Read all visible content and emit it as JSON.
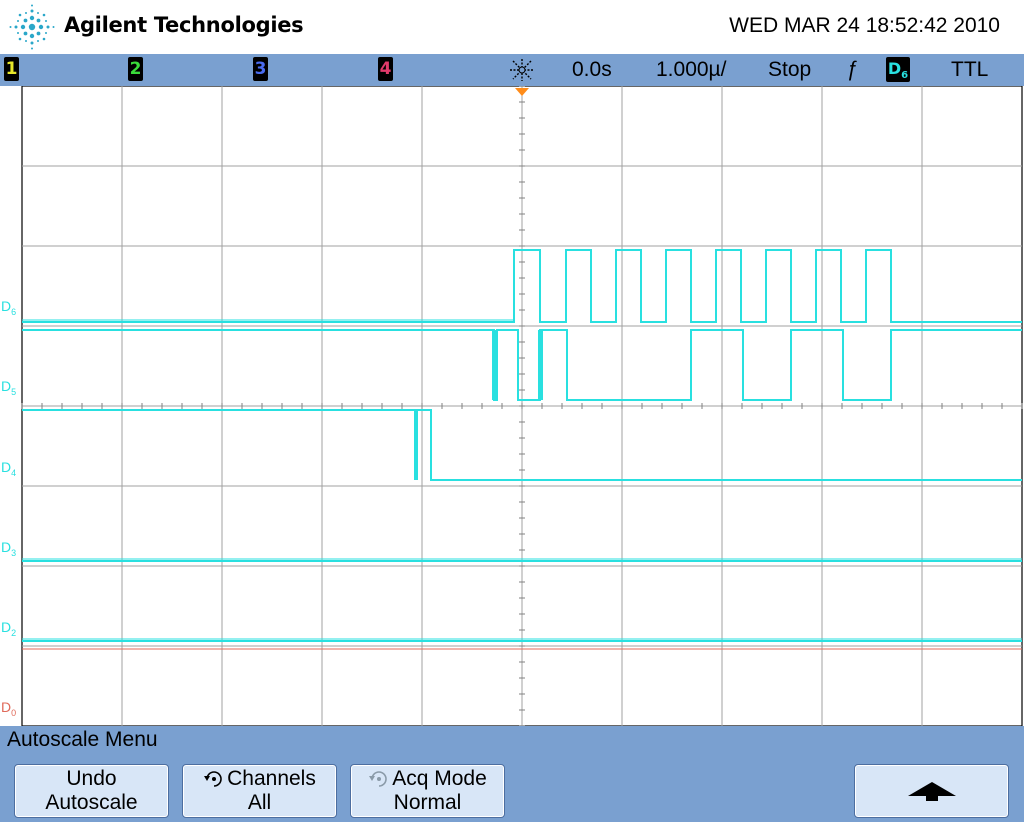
{
  "header": {
    "brand": "Agilent Technologies",
    "datetime": "WED MAR 24 18:52:42 2010"
  },
  "statusbar": {
    "channels": [
      {
        "label": "1",
        "color": "#e7e72a"
      },
      {
        "label": "2",
        "color": "#3adb3a"
      },
      {
        "label": "3",
        "color": "#4a6cf0"
      },
      {
        "label": "4",
        "color": "#e03a6a"
      }
    ],
    "time_ref": "0.0s",
    "timebase": "1.000µ/",
    "run_state": "Stop",
    "trigger_slope": "ƒ",
    "trigger_source": "D",
    "trigger_source_sub": "6",
    "trigger_level": "TTL"
  },
  "channel_labels": [
    {
      "name": "D",
      "sub": "6"
    },
    {
      "name": "D",
      "sub": "5"
    },
    {
      "name": "D",
      "sub": "4"
    },
    {
      "name": "D",
      "sub": "3"
    },
    {
      "name": "D",
      "sub": "2"
    },
    {
      "name": "D",
      "sub": "0"
    }
  ],
  "colors": {
    "trace": "#29e0e0",
    "d0_trace": "#e06a5a",
    "grid": "#a0a0a0",
    "trigger_marker": "#ff8c1a",
    "panel": "#7aa0d0"
  },
  "menu": {
    "title": "Autoscale Menu",
    "softkeys": [
      {
        "line1": "Undo",
        "line2": "Autoscale",
        "icon": ""
      },
      {
        "line1": "Channels",
        "line2": "All",
        "icon": "rotary-knob-icon"
      },
      {
        "line1": "Acq Mode",
        "line2": "Normal",
        "icon": "rotary-knob-icon"
      },
      {
        "line1": "",
        "line2": "",
        "icon": "up-arrow-icon"
      }
    ]
  }
}
